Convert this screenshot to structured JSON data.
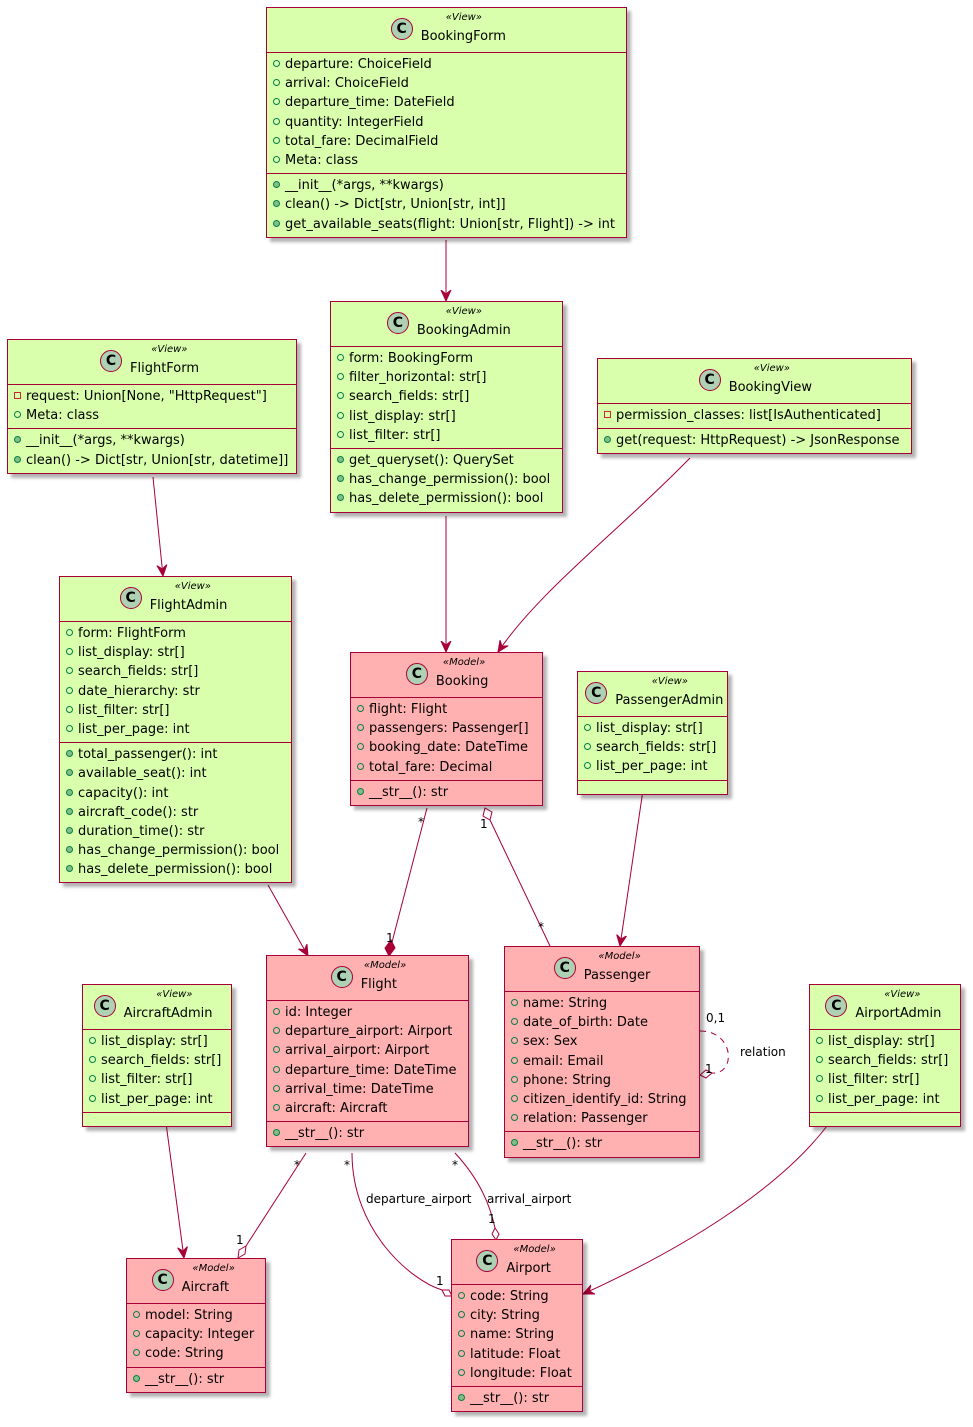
{
  "diagram": {
    "type": "UML class diagram",
    "colors": {
      "view_fill": "#d9ffad",
      "model_fill": "#ffb0b0",
      "border": "#a80036",
      "badge": "#add1b2"
    },
    "classes": {
      "BookingForm": {
        "stereotype": "«View»",
        "name": "BookingForm",
        "kind": "view",
        "icon": "class-c-icon",
        "fields": [
          {
            "vis": "public",
            "text": "departure: ChoiceField"
          },
          {
            "vis": "public",
            "text": "arrival: ChoiceField"
          },
          {
            "vis": "public",
            "text": "departure_time: DateField"
          },
          {
            "vis": "public",
            "text": "quantity: IntegerField"
          },
          {
            "vis": "public",
            "text": "total_fare: DecimalField"
          },
          {
            "vis": "public",
            "text": "Meta: class"
          }
        ],
        "methods": [
          {
            "vis": "public",
            "text": "__init__(*args, **kwargs)"
          },
          {
            "vis": "public",
            "text": "clean() -> Dict[str, Union[str, int]]"
          },
          {
            "vis": "public",
            "text": "get_available_seats(flight: Union[str, Flight]) -> int"
          }
        ]
      },
      "FlightForm": {
        "stereotype": "«View»",
        "name": "FlightForm",
        "kind": "view",
        "icon": "class-c-icon",
        "fields": [
          {
            "vis": "private",
            "text": "request: Union[None, \"HttpRequest\"]"
          },
          {
            "vis": "public",
            "text": "Meta: class"
          }
        ],
        "methods": [
          {
            "vis": "public",
            "text": "__init__(*args, **kwargs)"
          },
          {
            "vis": "public",
            "text": "clean() -> Dict[str, Union[str, datetime]]"
          }
        ]
      },
      "BookingAdmin": {
        "stereotype": "«View»",
        "name": "BookingAdmin",
        "kind": "view",
        "icon": "class-c-icon",
        "fields": [
          {
            "vis": "public",
            "text": "form: BookingForm"
          },
          {
            "vis": "public",
            "text": "filter_horizontal: str[]"
          },
          {
            "vis": "public",
            "text": "search_fields: str[]"
          },
          {
            "vis": "public",
            "text": "list_display: str[]"
          },
          {
            "vis": "public",
            "text": "list_filter: str[]"
          }
        ],
        "methods": [
          {
            "vis": "public",
            "text": "get_queryset(): QuerySet"
          },
          {
            "vis": "public",
            "text": "has_change_permission(): bool"
          },
          {
            "vis": "public",
            "text": "has_delete_permission(): bool"
          }
        ]
      },
      "BookingView": {
        "stereotype": "«View»",
        "name": "BookingView",
        "kind": "view",
        "icon": "class-c-icon",
        "fields": [
          {
            "vis": "private",
            "text": "permission_classes: list[IsAuthenticated]"
          }
        ],
        "methods": [
          {
            "vis": "public",
            "text": "get(request: HttpRequest) -> JsonResponse"
          }
        ]
      },
      "FlightAdmin": {
        "stereotype": "«View»",
        "name": "FlightAdmin",
        "kind": "view",
        "icon": "class-c-icon",
        "fields": [
          {
            "vis": "public",
            "text": "form: FlightForm"
          },
          {
            "vis": "public",
            "text": "list_display: str[]"
          },
          {
            "vis": "public",
            "text": "search_fields: str[]"
          },
          {
            "vis": "public",
            "text": "date_hierarchy: str"
          },
          {
            "vis": "public",
            "text": "list_filter: str[]"
          },
          {
            "vis": "public",
            "text": "list_per_page: int"
          }
        ],
        "methods": [
          {
            "vis": "public",
            "text": "total_passenger(): int"
          },
          {
            "vis": "public",
            "text": "available_seat(): int"
          },
          {
            "vis": "public",
            "text": "capacity(): int"
          },
          {
            "vis": "public",
            "text": "aircraft_code(): str"
          },
          {
            "vis": "public",
            "text": "duration_time(): str"
          },
          {
            "vis": "public",
            "text": "has_change_permission(): bool"
          },
          {
            "vis": "public",
            "text": "has_delete_permission(): bool"
          }
        ]
      },
      "Booking": {
        "stereotype": "«Model»",
        "name": "Booking",
        "kind": "model",
        "icon": "class-c-icon",
        "fields": [
          {
            "vis": "public",
            "text": "flight: Flight"
          },
          {
            "vis": "public",
            "text": "passengers: Passenger[]"
          },
          {
            "vis": "public",
            "text": "booking_date: DateTime"
          },
          {
            "vis": "public",
            "text": "total_fare: Decimal"
          }
        ],
        "methods": [
          {
            "vis": "public",
            "text": "__str__(): str"
          }
        ]
      },
      "PassengerAdmin": {
        "stereotype": "«View»",
        "name": "PassengerAdmin",
        "kind": "view",
        "icon": "class-c-icon",
        "fields": [
          {
            "vis": "public",
            "text": "list_display: str[]"
          },
          {
            "vis": "public",
            "text": "search_fields: str[]"
          },
          {
            "vis": "public",
            "text": "list_per_page: int"
          }
        ],
        "methods": []
      },
      "Flight": {
        "stereotype": "«Model»",
        "name": "Flight",
        "kind": "model",
        "icon": "class-c-icon",
        "fields": [
          {
            "vis": "public",
            "text": "id: Integer"
          },
          {
            "vis": "public",
            "text": "departure_airport: Airport"
          },
          {
            "vis": "public",
            "text": "arrival_airport: Airport"
          },
          {
            "vis": "public",
            "text": "departure_time: DateTime"
          },
          {
            "vis": "public",
            "text": "arrival_time: DateTime"
          },
          {
            "vis": "public",
            "text": "aircraft: Aircraft"
          }
        ],
        "methods": [
          {
            "vis": "public",
            "text": "__str__(): str"
          }
        ]
      },
      "Passenger": {
        "stereotype": "«Model»",
        "name": "Passenger",
        "kind": "model",
        "icon": "class-c-icon",
        "fields": [
          {
            "vis": "public",
            "text": "name: String"
          },
          {
            "vis": "public",
            "text": "date_of_birth: Date"
          },
          {
            "vis": "public",
            "text": "sex: Sex"
          },
          {
            "vis": "public",
            "text": "email: Email"
          },
          {
            "vis": "public",
            "text": "phone: String"
          },
          {
            "vis": "public",
            "text": "citizen_identify_id: String"
          },
          {
            "vis": "public",
            "text": "relation: Passenger"
          }
        ],
        "methods": [
          {
            "vis": "public",
            "text": "__str__(): str"
          }
        ]
      },
      "AircraftAdmin": {
        "stereotype": "«View»",
        "name": "AircraftAdmin",
        "kind": "view",
        "icon": "class-c-icon",
        "fields": [
          {
            "vis": "public",
            "text": "list_display: str[]"
          },
          {
            "vis": "public",
            "text": "search_fields: str[]"
          },
          {
            "vis": "public",
            "text": "list_filter: str[]"
          },
          {
            "vis": "public",
            "text": "list_per_page: int"
          }
        ],
        "methods": []
      },
      "AirportAdmin": {
        "stereotype": "«View»",
        "name": "AirportAdmin",
        "kind": "view",
        "icon": "class-c-icon",
        "fields": [
          {
            "vis": "public",
            "text": "list_display: str[]"
          },
          {
            "vis": "public",
            "text": "search_fields: str[]"
          },
          {
            "vis": "public",
            "text": "list_filter: str[]"
          },
          {
            "vis": "public",
            "text": "list_per_page: int"
          }
        ],
        "methods": []
      },
      "Aircraft": {
        "stereotype": "«Model»",
        "name": "Aircraft",
        "kind": "model",
        "icon": "class-c-icon",
        "fields": [
          {
            "vis": "public",
            "text": "model: String"
          },
          {
            "vis": "public",
            "text": "capacity: Integer"
          },
          {
            "vis": "public",
            "text": "code: String"
          }
        ],
        "methods": [
          {
            "vis": "public",
            "text": "__str__(): str"
          }
        ]
      },
      "Airport": {
        "stereotype": "«Model»",
        "name": "Airport",
        "kind": "model",
        "icon": "class-c-icon",
        "fields": [
          {
            "vis": "public",
            "text": "code: String"
          },
          {
            "vis": "public",
            "text": "city: String"
          },
          {
            "vis": "public",
            "text": "name: String"
          },
          {
            "vis": "public",
            "text": "latitude: Float"
          },
          {
            "vis": "public",
            "text": "longitude: Float"
          }
        ],
        "methods": [
          {
            "vis": "public",
            "text": "__str__(): str"
          }
        ]
      }
    },
    "relations": [
      {
        "from": "BookingForm",
        "to": "BookingAdmin",
        "type": "dependency-arrow"
      },
      {
        "from": "FlightForm",
        "to": "FlightAdmin",
        "type": "dependency-arrow"
      },
      {
        "from": "BookingAdmin",
        "to": "Booking",
        "type": "dependency-arrow"
      },
      {
        "from": "BookingView",
        "to": "Booking",
        "type": "dependency-arrow"
      },
      {
        "from": "FlightAdmin",
        "to": "Flight",
        "type": "dependency-arrow"
      },
      {
        "from": "PassengerAdmin",
        "to": "Passenger",
        "type": "dependency-arrow"
      },
      {
        "from": "AircraftAdmin",
        "to": "Aircraft",
        "type": "dependency-arrow"
      },
      {
        "from": "AirportAdmin",
        "to": "Airport",
        "type": "dependency-arrow"
      },
      {
        "from": "Booking",
        "to": "Flight",
        "type": "composition",
        "from_mult": "*",
        "to_mult": "1"
      },
      {
        "from": "Booking",
        "to": "Passenger",
        "type": "aggregation",
        "from_mult": "1",
        "to_mult": "*"
      },
      {
        "from": "Flight",
        "to": "Aircraft",
        "type": "aggregation",
        "from_mult": "*",
        "to_mult": "1"
      },
      {
        "from": "Flight",
        "to": "Airport",
        "type": "aggregation",
        "from_mult": "*",
        "to_mult": "1",
        "label": "departure_airport"
      },
      {
        "from": "Flight",
        "to": "Airport",
        "type": "aggregation",
        "from_mult": "*",
        "to_mult": "1",
        "label": "arrival_airport"
      },
      {
        "from": "Passenger",
        "to": "Passenger",
        "type": "aggregation-dashed",
        "from_mult": "0,1",
        "to_mult": "1",
        "label": "relation"
      }
    ]
  }
}
